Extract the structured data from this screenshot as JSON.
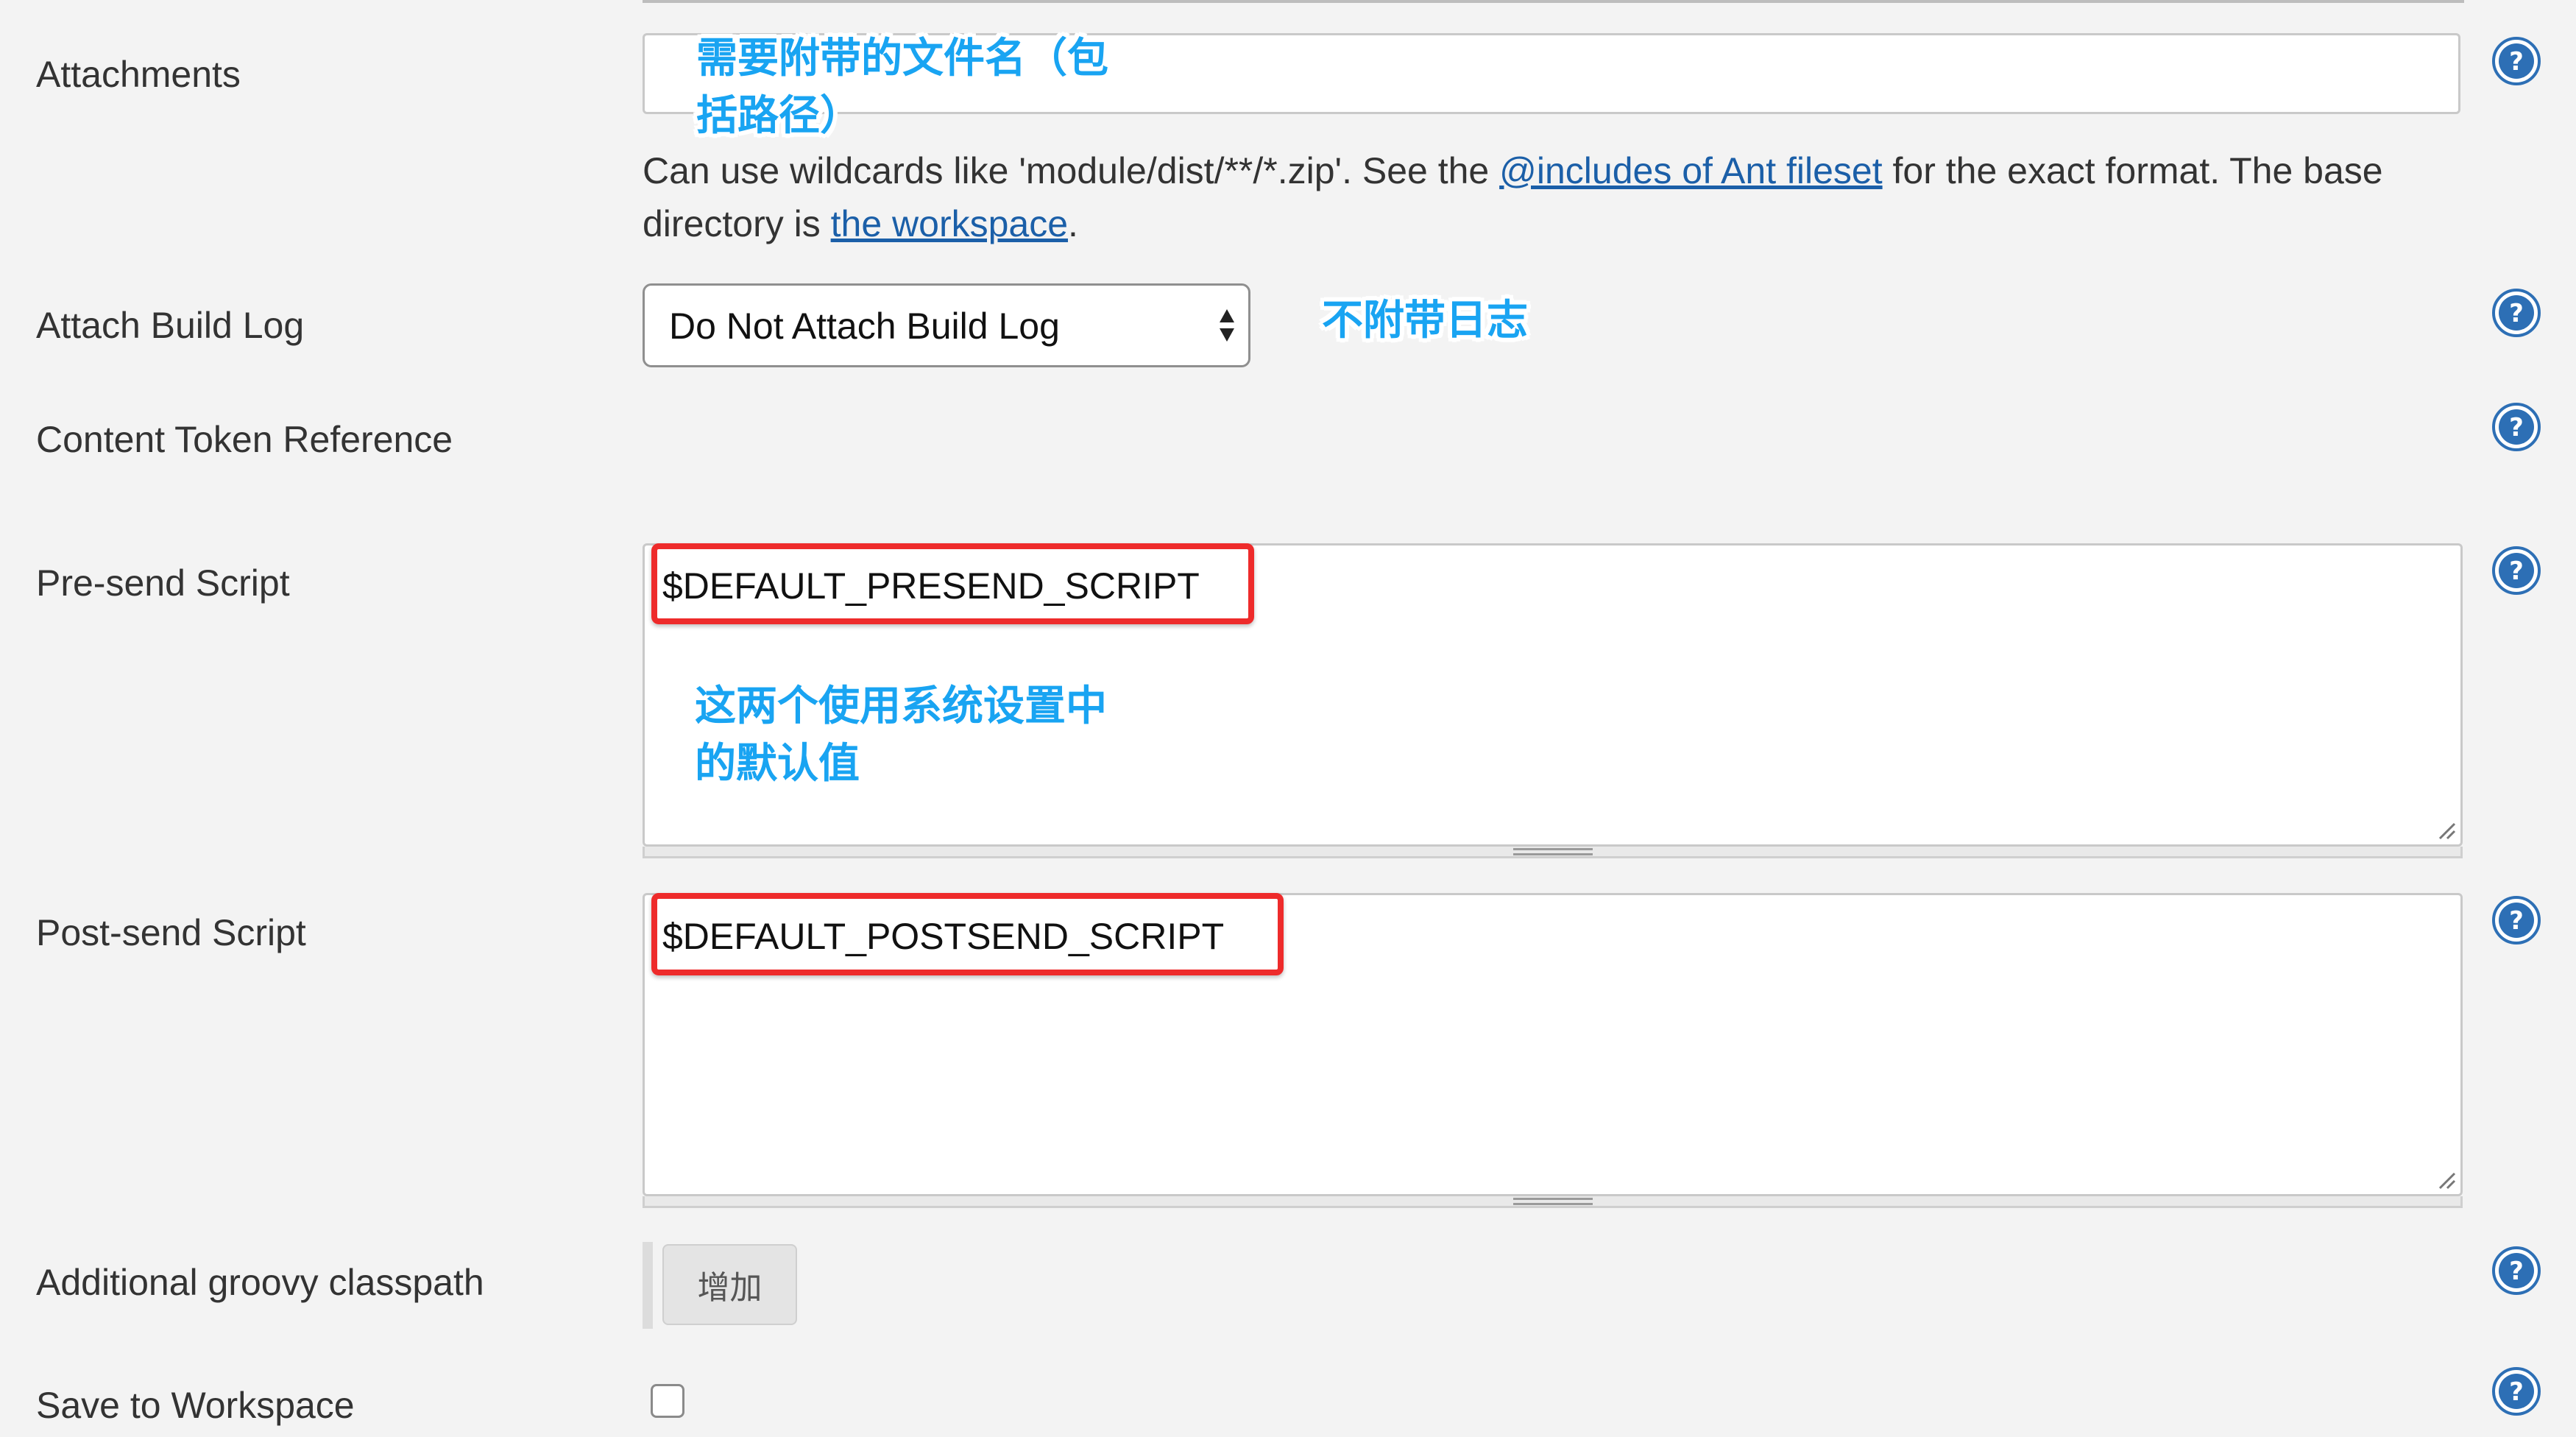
{
  "fields": {
    "attachments": {
      "label": "Attachments",
      "value": "",
      "description_pre": "Can use wildcards like 'module/dist/**/*.zip'. See the ",
      "description_link1": "@includes of Ant fileset",
      "description_mid": " for the exact format. The base directory is ",
      "description_link2": "the workspace",
      "description_post": "."
    },
    "attach_build_log": {
      "label": "Attach Build Log",
      "selected": "Do Not Attach Build Log"
    },
    "content_token_reference": {
      "label": "Content Token Reference"
    },
    "pre_send_script": {
      "label": "Pre-send Script",
      "value": "$DEFAULT_PRESEND_SCRIPT"
    },
    "post_send_script": {
      "label": "Post-send Script",
      "value": "$DEFAULT_POSTSEND_SCRIPT"
    },
    "additional_groovy_classpath": {
      "label": "Additional groovy classpath",
      "add_button": "增加"
    },
    "save_to_workspace": {
      "label": "Save to Workspace",
      "checked": false
    }
  },
  "annotations": {
    "attachments_line1": "需要附带的文件名（包",
    "attachments_line2": "括路径）",
    "build_log": "不附带日志",
    "scripts_line1": "这两个使用系统设置中",
    "scripts_line2": "的默认值"
  },
  "icons": {
    "help": "help-icon"
  },
  "colors": {
    "help_icon": "#2d6fb5",
    "highlight_border": "#ee2b2b",
    "annotation": "#19a4f2",
    "link": "#1b5fa8"
  }
}
